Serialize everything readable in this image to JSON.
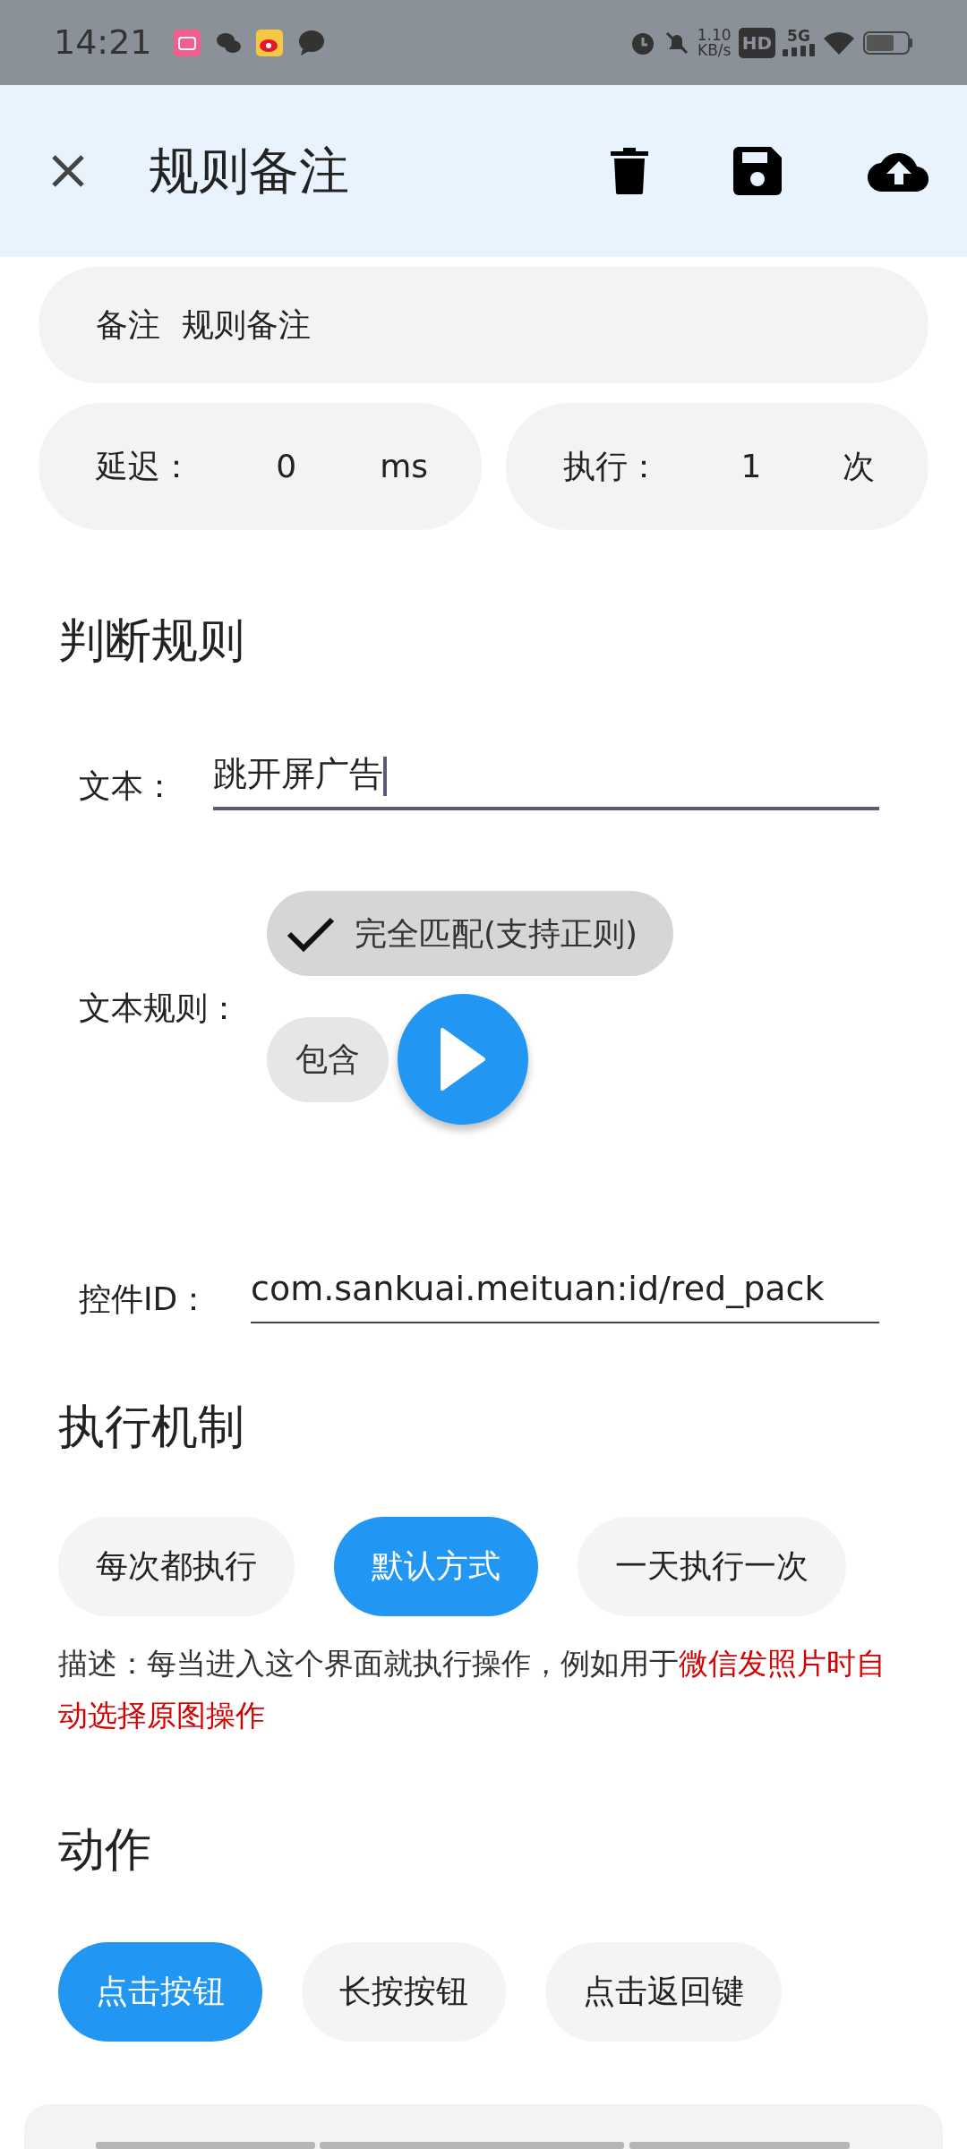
{
  "status_bar": {
    "time": "14:21",
    "net_speed": "1.10",
    "net_unit": "KB/s",
    "hd_badge": "HD",
    "network": "5G"
  },
  "app_bar": {
    "title": "规则备注"
  },
  "remark": {
    "label": "备注",
    "value": "规则备注"
  },
  "delay": {
    "label": "延迟：",
    "value": "0",
    "unit": "ms"
  },
  "repeat": {
    "label": "执行：",
    "value": "1",
    "unit": "次"
  },
  "judge": {
    "heading": "判断规则",
    "text_field": {
      "label": "文本：",
      "value": "跳开屏广告",
      "focused": true
    },
    "text_rule": {
      "label": "文本规则：",
      "options": [
        {
          "label": "完全匹配(支持正则)",
          "selected": true
        },
        {
          "label": "包含",
          "selected": false
        }
      ]
    },
    "control_id": {
      "label": "控件ID：",
      "value": "com.sankuai.meituan:id/red_pack",
      "focused": false
    }
  },
  "mechanism": {
    "heading": "执行机制",
    "options": [
      {
        "label": "每次都执行",
        "selected": false
      },
      {
        "label": "默认方式",
        "selected": true
      },
      {
        "label": "一天执行一次",
        "selected": false
      }
    ],
    "description": {
      "text": "描述：每当进入这个界面就执行操作，例如用于",
      "highlight": "微信发照片时自动选择原图操作"
    }
  },
  "actions": {
    "heading": "动作",
    "options": [
      {
        "label": "点击按钮",
        "selected": true
      },
      {
        "label": "长按按钮",
        "selected": false
      },
      {
        "label": "点击返回键",
        "selected": false
      }
    ]
  }
}
